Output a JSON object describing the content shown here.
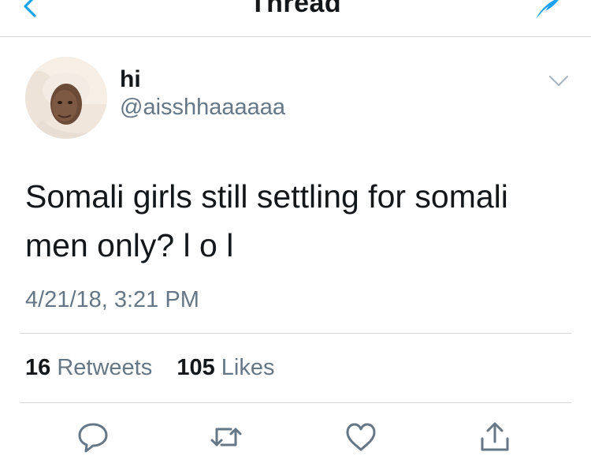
{
  "navbar": {
    "title": "Thread",
    "back_icon": "chevron-left-icon",
    "compose_icon": "feather-compose-icon"
  },
  "tweet": {
    "display_name": "hi",
    "handle": "@aisshhaaaaaa",
    "text": "Somali girls still settling for somali men only? l o l",
    "timestamp": "4/21/18, 3:21 PM",
    "retweets_count": "16",
    "retweets_label": "Retweets",
    "likes_count": "105",
    "likes_label": "Likes"
  },
  "actions": {
    "reply_icon": "reply-bubble-icon",
    "retweet_icon": "retweet-icon",
    "like_icon": "heart-icon",
    "share_icon": "share-upload-icon"
  },
  "colors": {
    "accent": "#1da1f2",
    "text_primary": "#14171a",
    "text_secondary": "#657786",
    "divider": "#d6d9db"
  }
}
